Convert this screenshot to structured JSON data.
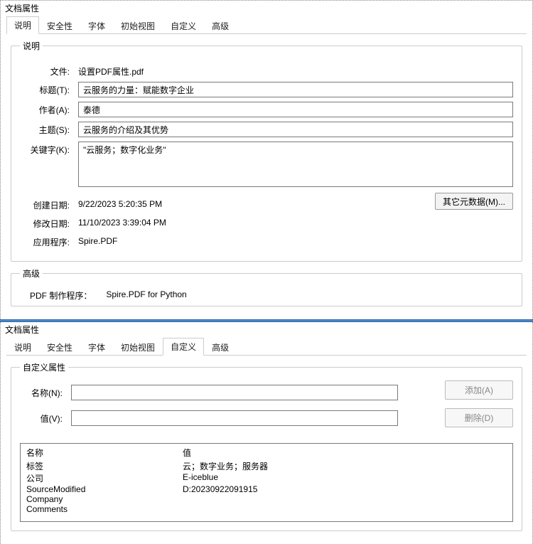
{
  "window_title": "文档属性",
  "tabs": {
    "description": "说明",
    "security": "安全性",
    "fonts": "字体",
    "initialview": "初始视图",
    "custom": "自定义",
    "advanced": "高级"
  },
  "top": {
    "group_title": "说明",
    "file_label": "文件:",
    "file_value": "设置PDF属性.pdf",
    "title_label": "标题(T):",
    "title_value": "云服务的力量：赋能数字企业",
    "author_label": "作者(A):",
    "author_value": "泰德",
    "subject_label": "主题(S):",
    "subject_value": "云服务的介绍及其优势",
    "keywords_label": "关键字(K):",
    "keywords_value": "\"云服务；数字化业务\"",
    "created_label": "创建日期:",
    "created_value": "9/22/2023 5:20:35 PM",
    "modified_label": "修改日期:",
    "modified_value": "11/10/2023 3:39:04 PM",
    "app_label": "应用程序:",
    "app_value": "Spire.PDF",
    "more_meta_button": "其它元数据(M)..."
  },
  "adv_group": {
    "title": "高级",
    "producer_label": "PDF 制作程序：",
    "producer_value": "Spire.PDF for Python"
  },
  "bottom": {
    "group_title": "自定义属性",
    "name_label": "名称(N):",
    "name_value": "",
    "value_label": "值(V):",
    "value_value": "",
    "add_button": "添加(A)",
    "delete_button": "删除(D)",
    "table": {
      "header_name": "名称",
      "header_value": "值",
      "rows": [
        {
          "name": "标签",
          "value": "云；数字业务；服务器"
        },
        {
          "name": "公司",
          "value": "E-iceblue"
        },
        {
          "name": "SourceModified",
          "value": "D:20230922091915"
        },
        {
          "name": "Company",
          "value": ""
        },
        {
          "name": "Comments",
          "value": ""
        }
      ]
    }
  }
}
